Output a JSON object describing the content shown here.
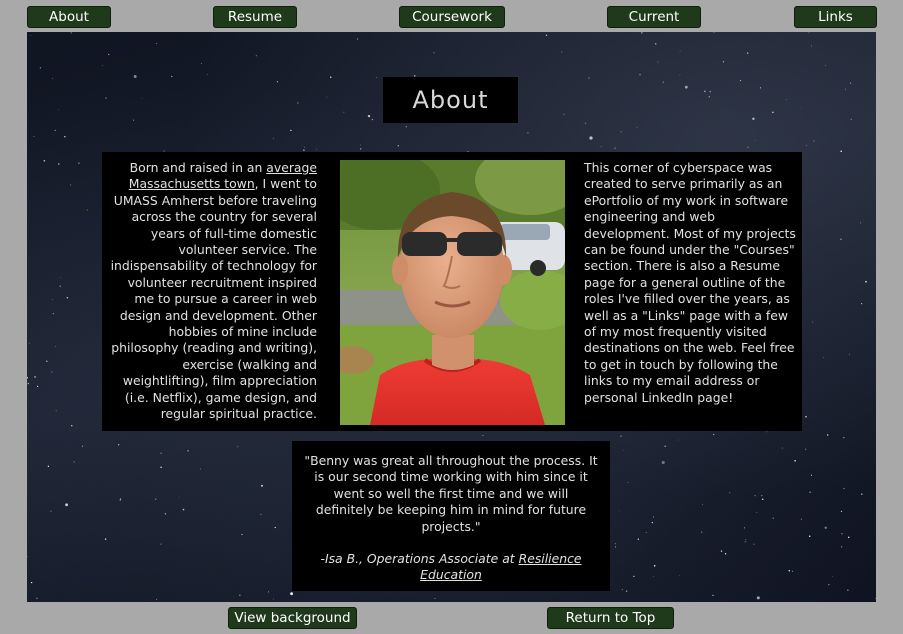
{
  "nav": {
    "items": [
      {
        "label": "About"
      },
      {
        "label": "Resume"
      },
      {
        "label": "Coursework"
      },
      {
        "label": "Current"
      },
      {
        "label": "Links"
      }
    ]
  },
  "page": {
    "title": "About"
  },
  "bio": {
    "left": {
      "intro": "Born and raised in an ",
      "link_text": "average Massachusetts town",
      "rest": ", I went to UMASS Amherst before  traveling across the country for several years of full-time domestic volunteer service. The indispensability of  technology for volunteer recruitment inspired me to pursue a career in web design and development. Other hobbies of mine include philosophy (reading and writing), exercise (walking and weightlifting), film appreciation (i.e. Netflix), game design, and regular spiritual practice."
    },
    "right": "This corner of cyberspace was created to serve primarily as an ePortfolio of my work in software engineering and web development. Most of my projects can be found under the \"Courses\" section. There is also a Resume page for a general outline of the roles I've filled over the years, as well as a \"Links\" page with a few of my most frequently visited destinations on the web. Feel free to get in touch by following the links to my email address or personal LinkedIn page!"
  },
  "quote": {
    "text": "\"Benny was great all throughout the process. It is our second time working with him since it went so well the first time and we will definitely be keeping him in mind for future projects.\"",
    "attribution_prefix": "-Isa B., Operations Associate at ",
    "attribution_link": "Resilience Education"
  },
  "footer": {
    "view_background_label": "View background",
    "return_top_label": "Return to Top"
  },
  "colors": {
    "button_bg": "#1f3a1b",
    "frame_gray": "#a9a9a9",
    "panel_bg": "#000000",
    "shirt_red": "#e8322d"
  }
}
